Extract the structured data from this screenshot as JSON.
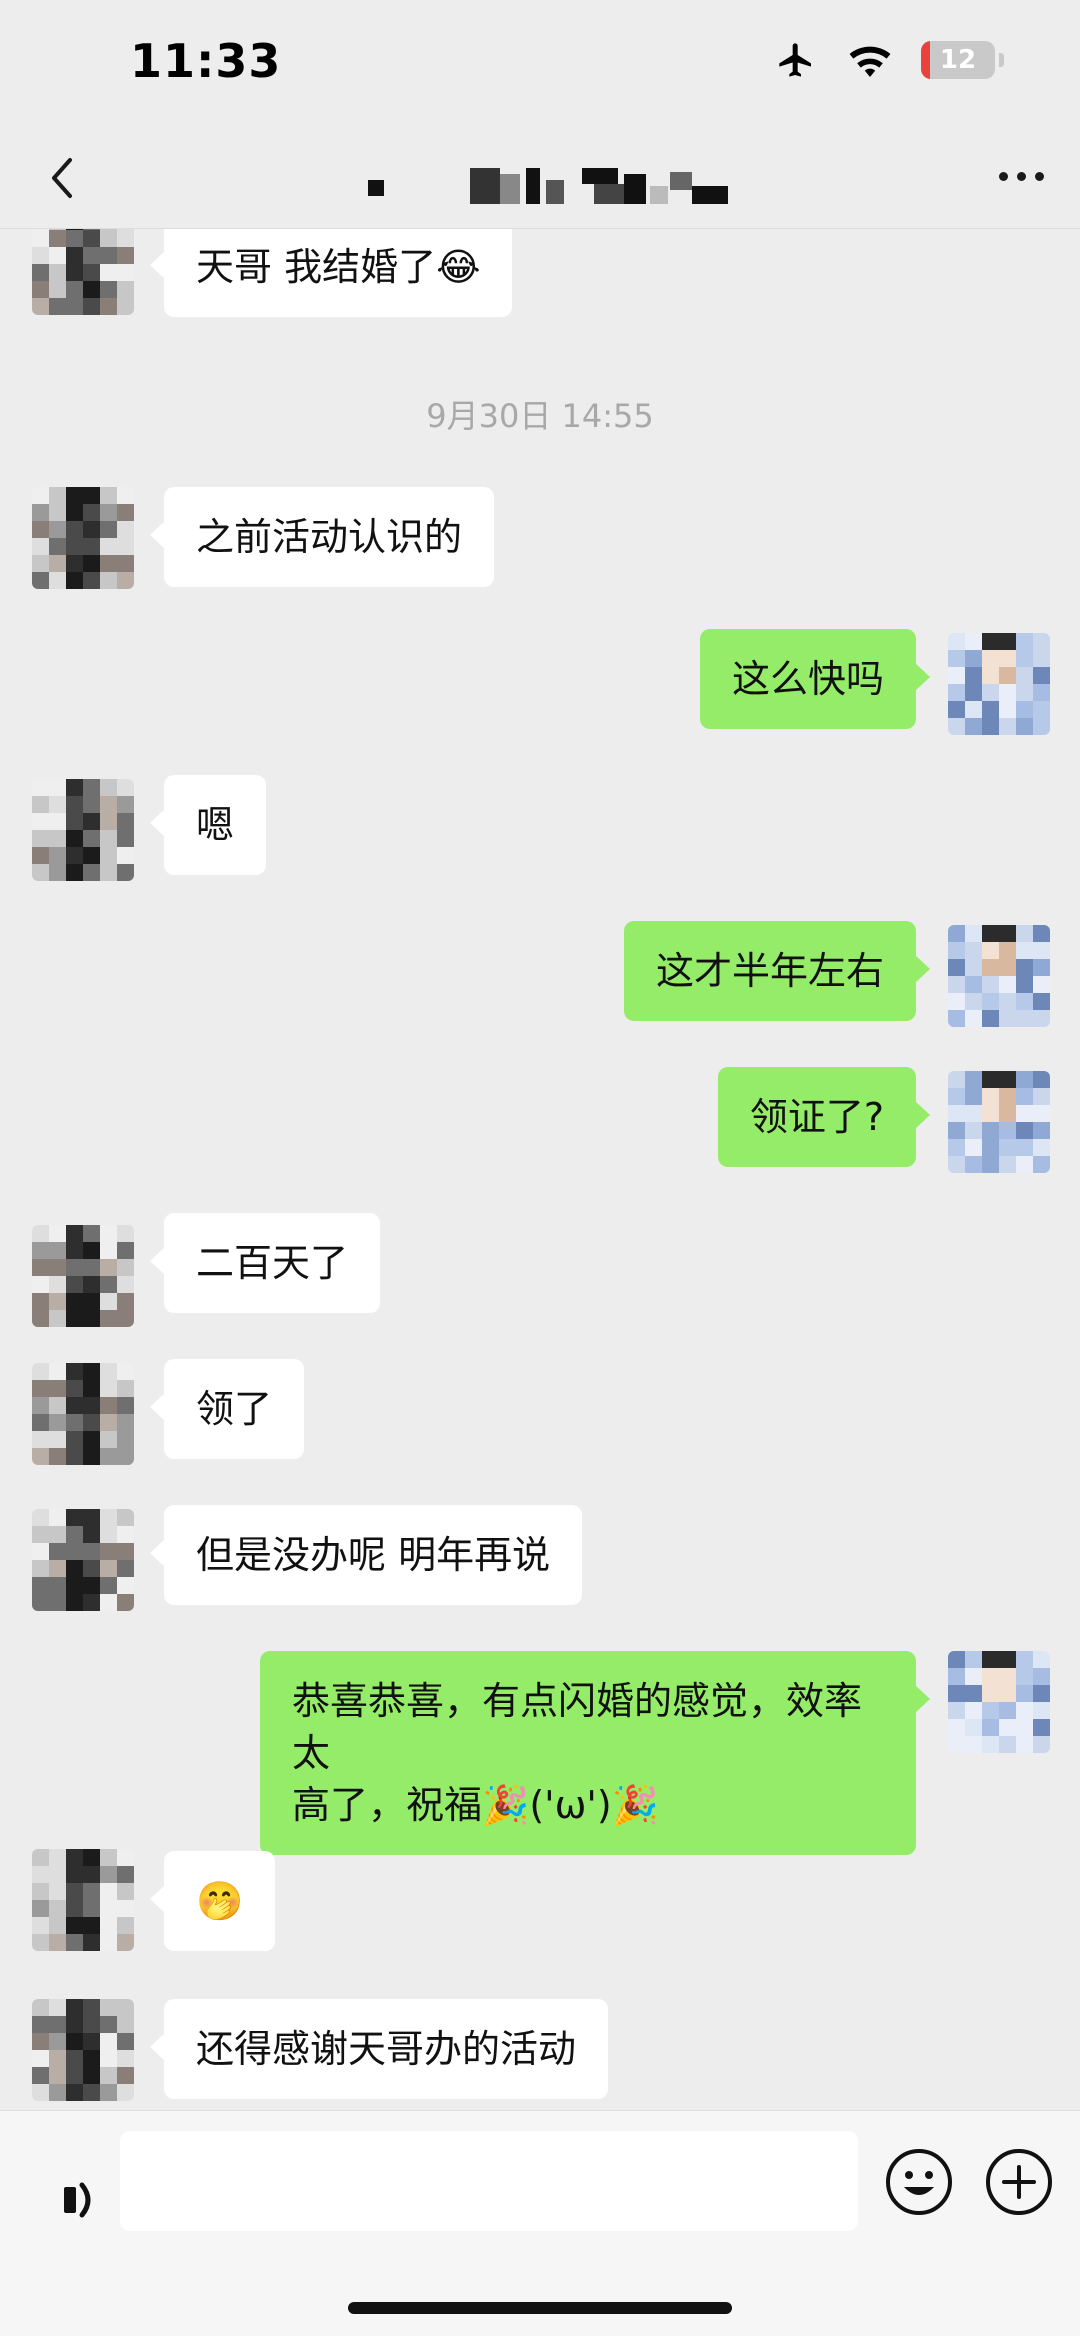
{
  "status_bar": {
    "time": "11:33",
    "battery_level": "12",
    "battery_fraction": 0.12
  },
  "nav": {
    "back_icon": "chevron-left-icon",
    "title_redacted": true,
    "more_icon": "more-dots-icon"
  },
  "messages": [
    {
      "side": "left",
      "text": "天哥 我结婚了😂"
    },
    {
      "type": "timestamp",
      "text": "9月30日 14:55"
    },
    {
      "side": "left",
      "text": "之前活动认识的"
    },
    {
      "side": "right",
      "text": "这么快吗"
    },
    {
      "side": "left",
      "text": "嗯"
    },
    {
      "side": "right",
      "text": "这才半年左右"
    },
    {
      "side": "right",
      "text": "领证了?"
    },
    {
      "side": "left",
      "text": "二百天了"
    },
    {
      "side": "left",
      "text": "领了"
    },
    {
      "side": "left",
      "text": "但是没办呢 明年再说"
    },
    {
      "side": "right",
      "text": "恭喜恭喜，有点闪婚的感觉，效率太\n高了，祝福🎉('ω')🎉"
    },
    {
      "side": "left",
      "text": "🤭"
    },
    {
      "side": "left",
      "text": "还得感谢天哥办的活动"
    }
  ],
  "input_bar": {
    "voice_icon": "voice-icon",
    "input_value": "",
    "emoji_icon": "emoji-icon",
    "plus_icon": "plus-icon"
  },
  "colors": {
    "background": "#ededed",
    "bubble_self": "#95ec69",
    "bubble_other": "#ffffff",
    "timestamp": "#a8a8a8"
  }
}
